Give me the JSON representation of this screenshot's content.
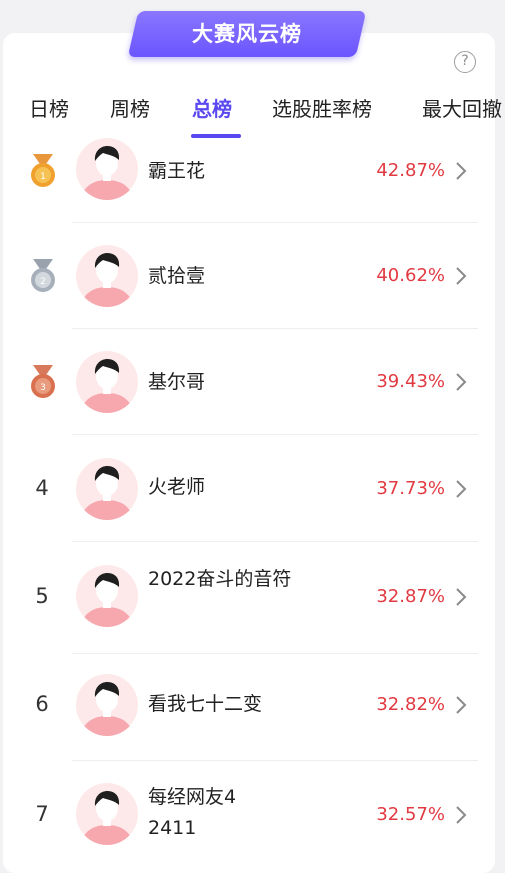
{
  "banner": {
    "title": "大赛风云榜"
  },
  "help_icon": "?",
  "tabs": [
    {
      "label": "日榜",
      "active": false
    },
    {
      "label": "周榜",
      "active": false
    },
    {
      "label": "总榜",
      "active": true
    },
    {
      "label": "选股胜率榜",
      "active": false
    },
    {
      "label": "最大回撤",
      "active": false
    }
  ],
  "colors": {
    "accent": "#5a48f0",
    "rate": "#e23a42",
    "banner": "#6b55ff"
  },
  "rankings": [
    {
      "rank": "1",
      "medal": "gold",
      "name": "霸王花",
      "rate": "42.87%"
    },
    {
      "rank": "2",
      "medal": "silver",
      "name": "贰拾壹",
      "rate": "40.62%"
    },
    {
      "rank": "3",
      "medal": "bronze",
      "name": "基尔哥",
      "rate": "39.43%"
    },
    {
      "rank": "4",
      "name": "火老师",
      "rate": "37.73%"
    },
    {
      "rank": "5",
      "name": "2022奋斗的音符",
      "rate": "32.87%"
    },
    {
      "rank": "6",
      "name": "看我七十二变",
      "rate": "32.82%"
    },
    {
      "rank": "7",
      "name": "每经网友42411",
      "rate": "32.57%"
    }
  ]
}
